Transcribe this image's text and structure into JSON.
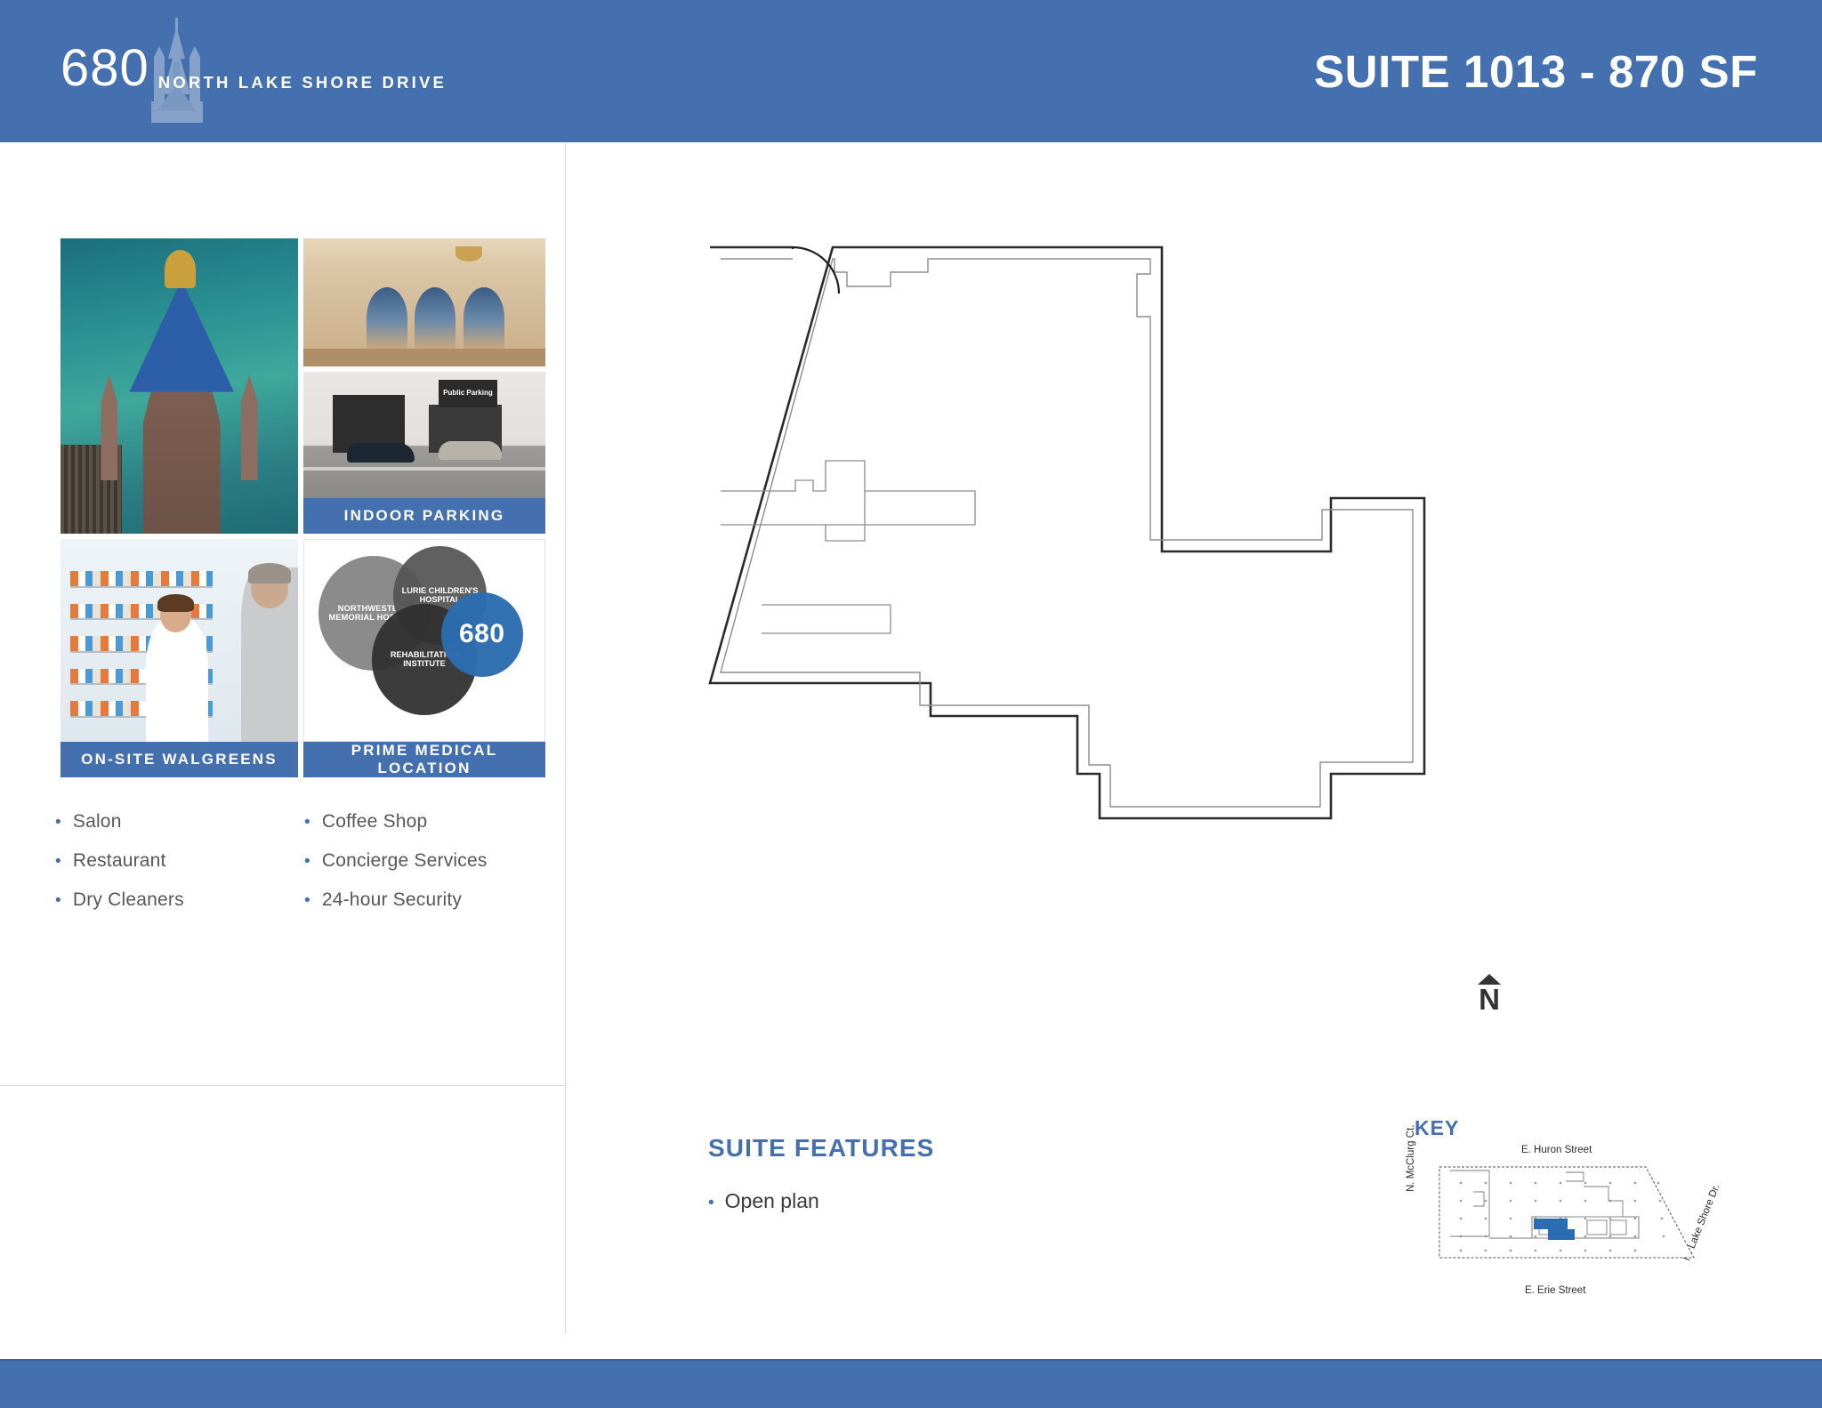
{
  "header": {
    "brand_number": "680",
    "brand_subtitle": "NORTH LAKE SHORE DRIVE",
    "tower_icon": "building-tower-icon",
    "title": "SUITE 1013 - 870 SF",
    "background_color": "#4470b0"
  },
  "left_panel": {
    "photos": [
      {
        "id": "building-exterior",
        "alt": "680 North Lake Shore Drive tower exterior over lake",
        "caption": ""
      },
      {
        "id": "lobby-interior",
        "alt": "Historic lobby interior with arches",
        "caption": ""
      },
      {
        "id": "indoor-parking",
        "alt": "Parking garage entrance with cars",
        "caption": "INDOOR PARKING",
        "sign_text": "Public Parking"
      },
      {
        "id": "onsite-walgreens",
        "alt": "Pharmacist assisting customer at Walgreens",
        "caption": "ON-SITE WALGREENS"
      },
      {
        "id": "prime-medical-location",
        "alt": "Venn diagram of nearby hospitals",
        "caption": "PRIME MEDICAL LOCATION"
      }
    ],
    "venn": {
      "circles": [
        {
          "label": "NORTHWESTERN MEMORIAL HOSPITAL",
          "color": "#828282"
        },
        {
          "label": "LURIE CHILDREN'S HOSPITAL",
          "color": "#545454"
        },
        {
          "label": "REHABILITATION INSTITUTE",
          "color": "#303030"
        },
        {
          "label": "680",
          "color": "#2b6cb0"
        }
      ]
    },
    "amenities": [
      "Salon",
      "Coffee Shop",
      "Restaurant",
      "Concierge Services",
      "Dry Cleaners",
      "24-hour Security"
    ]
  },
  "main": {
    "floorplan": {
      "name": "suite-1013-floorplan",
      "north_arrow_label": "N"
    },
    "features": {
      "title": "SUITE FEATURES",
      "items": [
        "Open plan"
      ]
    },
    "key": {
      "title": "KEY",
      "map_labels": {
        "top": "E. Huron Street",
        "bottom": "E. Erie Street",
        "left": "N. McClurg Ct.",
        "right": "N. Lake Shore Dr."
      },
      "highlight_color": "#2b6cb0"
    }
  },
  "footer": {
    "background_color": "#4470b0"
  }
}
